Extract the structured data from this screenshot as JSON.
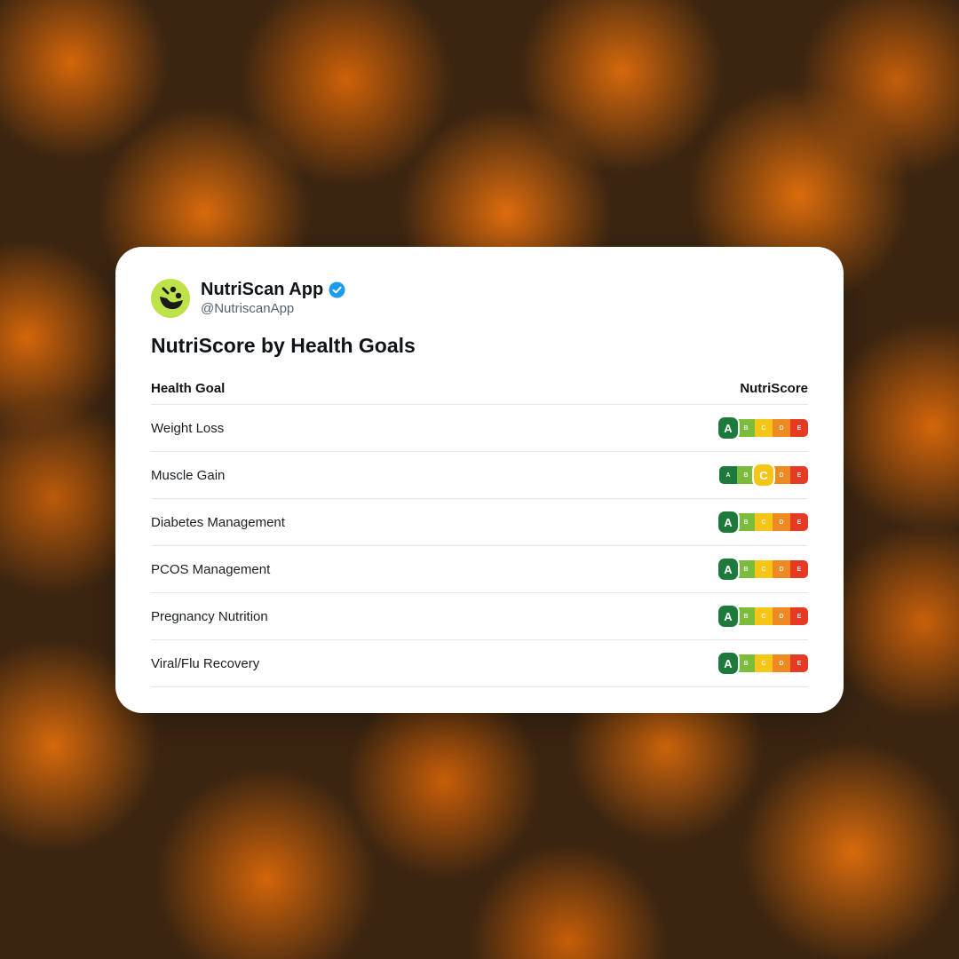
{
  "account": {
    "name": "NutriScan App",
    "handle": "@NutriscanApp",
    "verified_icon": "verified-badge-icon",
    "avatar_icon": "nutriscan-logo-icon"
  },
  "title": "NutriScore by Health Goals",
  "table": {
    "headers": {
      "goal": "Health Goal",
      "score": "NutriScore"
    },
    "grades": [
      "A",
      "B",
      "C",
      "D",
      "E"
    ],
    "grade_colors": {
      "A": "#1d7a3c",
      "B": "#7cbc3c",
      "C": "#f5c518",
      "D": "#ef8a22",
      "E": "#e53b25"
    },
    "rows": [
      {
        "goal": "Weight Loss",
        "score": "A"
      },
      {
        "goal": "Muscle Gain",
        "score": "C"
      },
      {
        "goal": "Diabetes Management",
        "score": "A"
      },
      {
        "goal": "PCOS Management",
        "score": "A"
      },
      {
        "goal": "Pregnancy Nutrition",
        "score": "A"
      },
      {
        "goal": "Viral/Flu Recovery",
        "score": "A"
      }
    ]
  },
  "colors": {
    "avatar_bg": "#bde24a",
    "verified": "#1d9bf0",
    "card_bg": "#ffffff",
    "background": "#3b2511"
  }
}
